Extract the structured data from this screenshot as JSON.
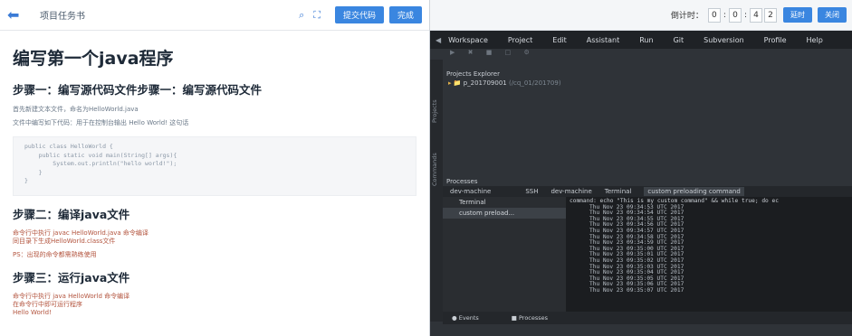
{
  "left": {
    "topbar": {
      "title": "项目任务书",
      "submit_label": "提交代码",
      "done_label": "完成"
    },
    "heading": "编写第一个java程序",
    "step1": {
      "title": "步骤一：编写源代码文件步骤一：编写源代码文件",
      "line1": "首先新建文本文件，命名为HelloWorld.java",
      "line2": "文件中编写如下代码：用于在控制台输出 Hello World! 这句话"
    },
    "code": {
      "lines": [
        "public class HelloWorld {",
        "    public static void main(String[] args){",
        "        System.out.println(\"hello world!\");",
        "    }",
        "}"
      ]
    },
    "step2": {
      "title": "步骤二：编译java文件",
      "line1": "命令行中执行 javac HelloWorld.java 命令编译",
      "line2": "同目录下生成HelloWorld.class文件",
      "line3": "PS：出现的命令都需熟练使用"
    },
    "step3": {
      "title": "步骤三：运行java文件",
      "line1": "命令行中执行 java HelloWorld 命令编译",
      "line2": "在命令行中即可运行程序",
      "line3": "Hello World!"
    }
  },
  "right": {
    "timer": {
      "label": "倒计时：",
      "d1": "0",
      "d2": "0",
      "d3": "4",
      "d4": "2",
      "btn1": "延时",
      "btn2": "关闭"
    },
    "menu": [
      "Workspace",
      "Project",
      "Edit",
      "Assistant",
      "Run",
      "Git",
      "Subversion",
      "Profile",
      "Help"
    ],
    "explorer_title": "Projects Explorer",
    "project_name": "p_201709001",
    "project_path": "(/cq_01/201709)",
    "side_labels": [
      "Projects",
      "Commands"
    ],
    "processes_label": "Processes",
    "proc_header": {
      "machine": "dev-machine",
      "ssh": "SSH",
      "tab1": "dev-machine",
      "tab2": "Terminal",
      "tab3": "custom preloading command"
    },
    "proc_items": [
      "Terminal",
      "custom preload..."
    ],
    "terminal": {
      "command": "command: echo \"This is my custom command\" && while true; do ec",
      "lines": [
        "Thu Nov 23 09:34:53 UTC 2017",
        "Thu Nov 23 09:34:54 UTC 2017",
        "Thu Nov 23 09:34:55 UTC 2017",
        "Thu Nov 23 09:34:56 UTC 2017",
        "Thu Nov 23 09:34:57 UTC 2017",
        "Thu Nov 23 09:34:58 UTC 2017",
        "Thu Nov 23 09:34:59 UTC 2017",
        "Thu Nov 23 09:35:00 UTC 2017",
        "Thu Nov 23 09:35:01 UTC 2017",
        "Thu Nov 23 09:35:02 UTC 2017",
        "Thu Nov 23 09:35:03 UTC 2017",
        "Thu Nov 23 09:35:04 UTC 2017",
        "Thu Nov 23 09:35:05 UTC 2017",
        "Thu Nov 23 09:35:06 UTC 2017",
        "Thu Nov 23 09:35:07 UTC 2017"
      ]
    },
    "bottom": {
      "events": "Events",
      "processes": "Processes"
    }
  }
}
